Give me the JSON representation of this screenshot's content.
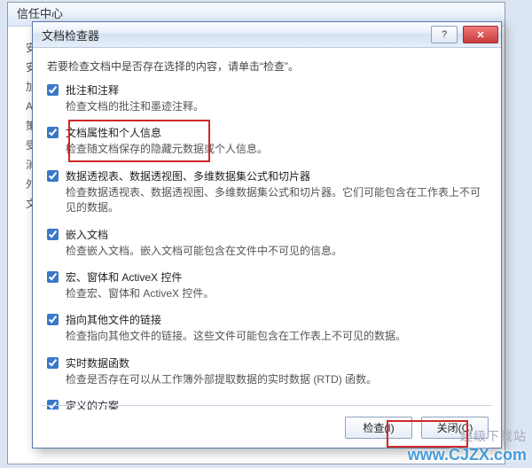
{
  "background_window": {
    "title": "信任中心",
    "side_items": [
      "安",
      "安",
      "加",
      "A",
      "策",
      "受",
      "消",
      "外",
      "文"
    ]
  },
  "dialog": {
    "title": "文档检查器",
    "intro": "若要检查文档中是否存在选择的内容，请单击“检查”。",
    "items": [
      {
        "label": "批注和注释",
        "desc": "检查文档的批注和墨迹注释。",
        "checked": true
      },
      {
        "label": "文档属性和个人信息",
        "desc": "检查随文档保存的隐藏元数据或个人信息。",
        "checked": true
      },
      {
        "label": "数据透视表、数据透视图、多维数据集公式和切片器",
        "desc": "检查数据透视表、数据透视图、多维数据集公式和切片器。它们可能包含在工作表上不可见的数据。",
        "checked": true
      },
      {
        "label": "嵌入文档",
        "desc": "检查嵌入文档。嵌入文档可能包含在文件中不可见的信息。",
        "checked": true
      },
      {
        "label": "宏、窗体和 ActiveX 控件",
        "desc": "检查宏、窗体和 ActiveX 控件。",
        "checked": true
      },
      {
        "label": "指向其他文件的链接",
        "desc": "检查指向其他文件的链接。这些文件可能包含在工作表上不可见的数据。",
        "checked": true
      },
      {
        "label": "实时数据函数",
        "desc": "检查是否存在可以从工作簿外部提取数据的实时数据 (RTD) 函数。",
        "checked": true
      },
      {
        "label": "定义的方案",
        "desc": "",
        "checked": true
      }
    ],
    "buttons": {
      "inspect": "检查(I)",
      "close": "关闭(C)"
    }
  },
  "watermark": {
    "small": "超级下载站",
    "url": "www.CJZX.com"
  }
}
